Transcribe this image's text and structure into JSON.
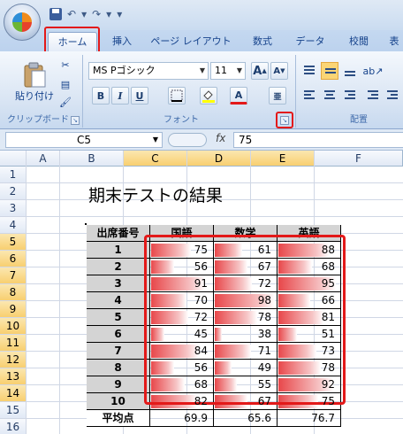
{
  "qat": {
    "undo": "↶",
    "redo": "↷",
    "dropdown": "▾"
  },
  "tabs": [
    "ホーム",
    "挿入",
    "ページ レイアウト",
    "数式",
    "データ",
    "校閲",
    "表"
  ],
  "ribbon": {
    "clipboard": {
      "paste_label": "貼り付け",
      "group_label": "クリップボード"
    },
    "font": {
      "font_name": "MS Pゴシック",
      "font_size": "11",
      "group_label": "フォント",
      "bold": "B",
      "italic": "I",
      "underline": "U",
      "grow": "A",
      "shrink": "A",
      "color_a": "A"
    },
    "alignment": {
      "group_label": "配置"
    }
  },
  "formula_bar": {
    "name_box": "C5",
    "fx": "fx",
    "content": "75"
  },
  "columns": [
    "A",
    "B",
    "C",
    "D",
    "E",
    "F"
  ],
  "rows": [
    "1",
    "2",
    "3",
    "4",
    "5",
    "6",
    "7",
    "8",
    "9",
    "10",
    "11",
    "12",
    "13",
    "14",
    "15",
    "16"
  ],
  "sheet": {
    "title": "期末テストの結果",
    "headers": [
      "出席番号",
      "国語",
      "数学",
      "英語"
    ],
    "records": [
      {
        "id": "1",
        "kokugo": 75,
        "sugaku": 61,
        "eigo": 88
      },
      {
        "id": "2",
        "kokugo": 56,
        "sugaku": 67,
        "eigo": 68
      },
      {
        "id": "3",
        "kokugo": 91,
        "sugaku": 72,
        "eigo": 95
      },
      {
        "id": "4",
        "kokugo": 70,
        "sugaku": 98,
        "eigo": 66
      },
      {
        "id": "5",
        "kokugo": 72,
        "sugaku": 78,
        "eigo": 81
      },
      {
        "id": "6",
        "kokugo": 45,
        "sugaku": 38,
        "eigo": 51
      },
      {
        "id": "7",
        "kokugo": 84,
        "sugaku": 71,
        "eigo": 73
      },
      {
        "id": "8",
        "kokugo": 56,
        "sugaku": 49,
        "eigo": 78
      },
      {
        "id": "9",
        "kokugo": 68,
        "sugaku": 55,
        "eigo": 92
      },
      {
        "id": "10",
        "kokugo": 82,
        "sugaku": 67,
        "eigo": 75
      }
    ],
    "average_label": "平均点",
    "averages": {
      "kokugo": "69.9",
      "sugaku": "65.6",
      "eigo": "76.7"
    }
  },
  "colors": {
    "databar": "#e8474a",
    "highlight": "#e31919",
    "header_fill": "#d4d4d4"
  }
}
